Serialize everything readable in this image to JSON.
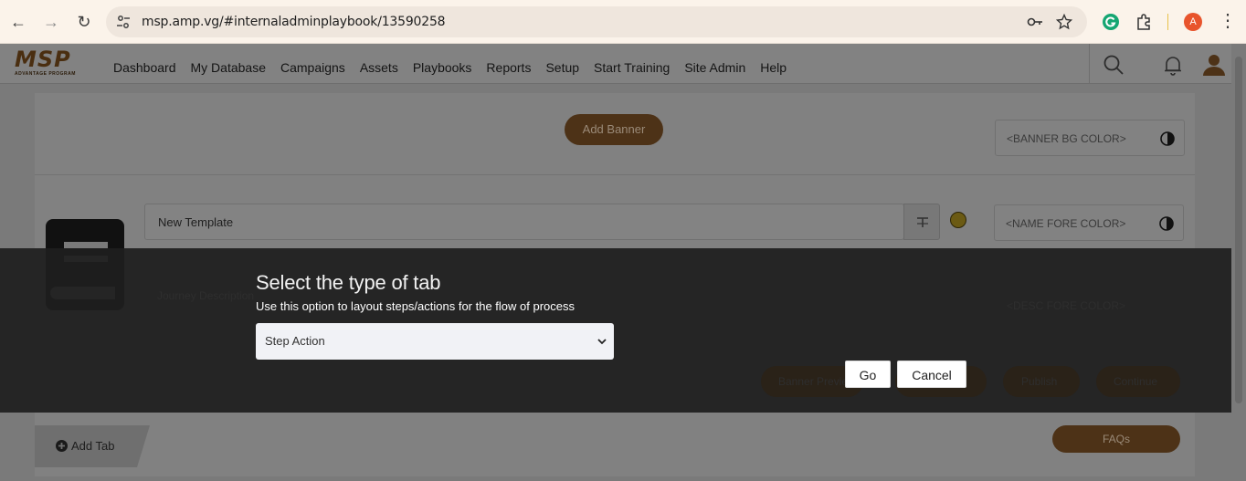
{
  "browser": {
    "url": "msp.amp.vg/#internaladminplaybook/13590258",
    "profile_initial": "A"
  },
  "app": {
    "logo_text": "MSP",
    "logo_subtext": "ADVANTAGE PROGRAM",
    "menu": [
      "Dashboard",
      "My Database",
      "Campaigns",
      "Assets",
      "Playbooks",
      "Reports",
      "Setup",
      "Start Training",
      "Site Admin",
      "Help"
    ]
  },
  "page": {
    "add_banner": "Add Banner",
    "banner_bg_color_placeholder": "<BANNER BG COLOR>",
    "name_fore_color_placeholder": "<NAME FORE COLOR>",
    "descriptor_color_placeholder": "<DESC FORE COLOR>",
    "template_name": "New Template",
    "journey_placeholder": "Journey Description",
    "banner_preview": "Banner Preview",
    "publish": "Publish",
    "continue": "Continue",
    "add_tab": "Add Tab",
    "faqs": "FAQs"
  },
  "modal": {
    "title": "Select the type of tab",
    "subtitle": "Use this option to layout steps/actions for the flow of process",
    "selected_option": "Step Action",
    "go": "Go",
    "cancel": "Cancel"
  },
  "colors": {
    "brand_brown": "#4d3217",
    "modal_band": "#1e1e1e"
  }
}
